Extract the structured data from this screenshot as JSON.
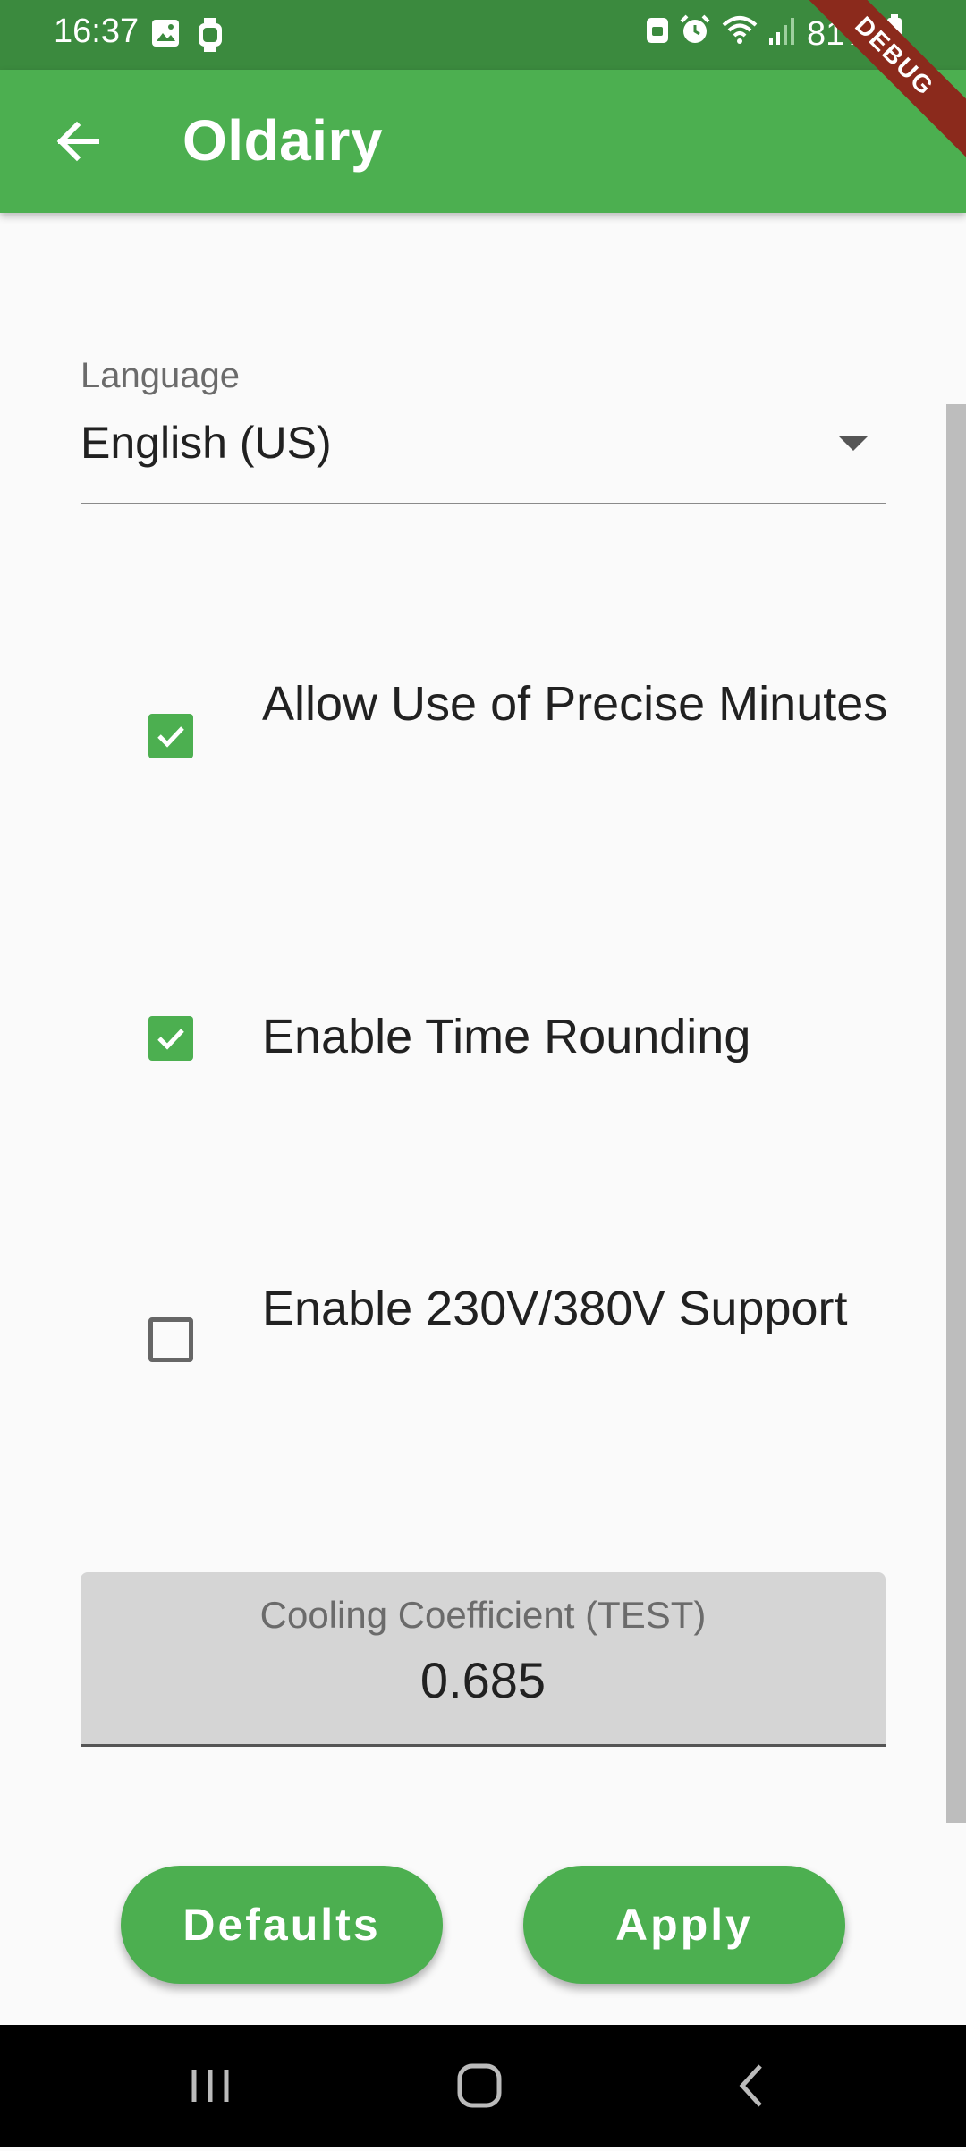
{
  "status_bar": {
    "time": "16:37",
    "battery": "81%",
    "icons": [
      "image-icon",
      "watch-icon",
      "android-icon",
      "alarm-icon",
      "wifi-icon",
      "signal-icon",
      "battery-icon"
    ]
  },
  "app_bar": {
    "title": "Oldairy",
    "back_icon": "arrow-back-icon"
  },
  "debug_banner": "DEBUG",
  "language": {
    "label": "Language",
    "value": "English (US)"
  },
  "options": [
    {
      "label": "Allow Use of Precise Minutes",
      "checked": true
    },
    {
      "label": "Enable Time Rounding",
      "checked": true
    },
    {
      "label": "Enable 230V/380V Support",
      "checked": false
    }
  ],
  "cooling": {
    "label": "Cooling Coefficient (TEST)",
    "value": "0.685"
  },
  "buttons": {
    "defaults": "Defaults",
    "apply": "Apply"
  },
  "colors": {
    "primary": "#4caf50",
    "status_bar": "#3b8a3e"
  },
  "nav_bar": [
    "recents-icon",
    "home-icon",
    "back-icon"
  ]
}
